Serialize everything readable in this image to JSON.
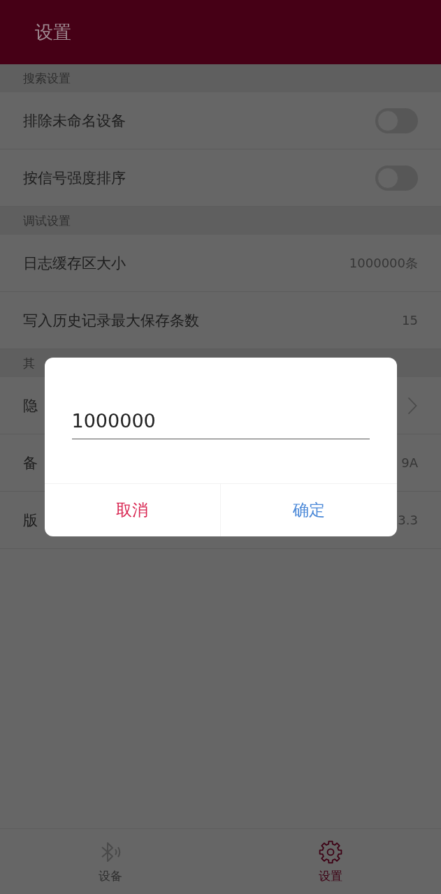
{
  "app_bar": {
    "title": "设置"
  },
  "sections": [
    {
      "title": "搜索设置",
      "items": [
        {
          "kind": "switch",
          "label": "排除未命名设备",
          "on": false
        },
        {
          "kind": "switch",
          "label": "按信号强度排序",
          "on": false
        }
      ]
    },
    {
      "title": "调试设置",
      "items": [
        {
          "kind": "value",
          "label": "日志缓存区大小",
          "value": "1000000条"
        },
        {
          "kind": "value",
          "label": "写入历史记录最大保存条数",
          "value": "15"
        }
      ]
    },
    {
      "title": "其",
      "items": [
        {
          "kind": "link",
          "label": "隐"
        },
        {
          "kind": "value",
          "label": "备",
          "value": "9A"
        },
        {
          "kind": "value",
          "label": "版",
          "value": "3.3"
        }
      ]
    }
  ],
  "dialog": {
    "input_value": "1000000",
    "buttons": [
      {
        "kind": "cancel",
        "label": "取消"
      },
      {
        "kind": "confirm",
        "label": "确定"
      }
    ]
  },
  "bottom_nav": [
    {
      "label": "设备",
      "selected": false
    },
    {
      "label": "设置",
      "selected": true
    }
  ]
}
